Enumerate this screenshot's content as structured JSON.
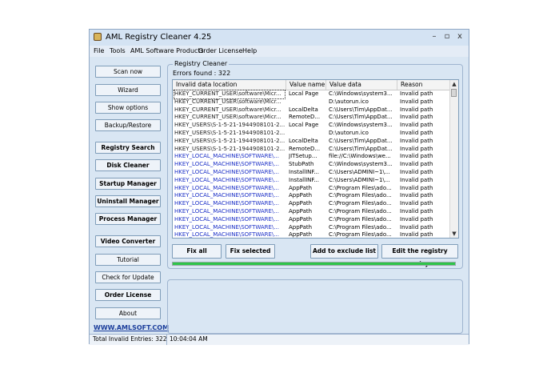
{
  "window": {
    "title": "AML Registry Cleaner 4.25",
    "controls": {
      "minimize": "–",
      "maximize": "▫",
      "close": "x"
    }
  },
  "menu": [
    "File",
    "Tools",
    "AML Software Products",
    "Order License",
    "Help"
  ],
  "sidebar": {
    "buttons": [
      {
        "label": "Scan now",
        "bold": false
      },
      {
        "label": "Wizard",
        "bold": false
      },
      {
        "label": "Show options",
        "bold": false
      },
      {
        "label": "Backup/Restore",
        "bold": false
      },
      {
        "label": "Registry Search",
        "bold": true
      },
      {
        "label": "Disk Cleaner",
        "bold": true
      },
      {
        "label": "Startup Manager",
        "bold": true
      },
      {
        "label": "Uninstall Manager",
        "bold": true
      },
      {
        "label": "Process Manager",
        "bold": true
      },
      {
        "label": "Video Converter",
        "bold": true
      },
      {
        "label": "Tutorial",
        "bold": false
      },
      {
        "label": "Check for Update",
        "bold": false
      },
      {
        "label": "Order License",
        "bold": true
      },
      {
        "label": "About",
        "bold": false
      }
    ],
    "website": "WWW.AMLSOFT.COM"
  },
  "registry_cleaner": {
    "group_title": "Registry Cleaner",
    "errors_found": "Errors found : 322",
    "columns": [
      "Invalid data location",
      "Value name",
      "Value data",
      "Reason"
    ],
    "rows": [
      {
        "location": "HKEY_CURRENT_USER\\software\\Micr...",
        "name": "Local Page",
        "data": "C:\\Windows\\system3...",
        "reason": "Invalid path",
        "type": "user",
        "selected": true
      },
      {
        "location": "HKEY_CURRENT_USER\\software\\Micr...",
        "name": "",
        "data": "D:\\autorun.ico",
        "reason": "Invalid path",
        "type": "user",
        "selected": false
      },
      {
        "location": "HKEY_CURRENT_USER\\software\\Micr...",
        "name": "LocalDelta",
        "data": "C:\\Users\\Tim\\AppDat...",
        "reason": "Invalid path",
        "type": "user",
        "selected": false
      },
      {
        "location": "HKEY_CURRENT_USER\\software\\Micr...",
        "name": "RemoteD...",
        "data": "C:\\Users\\Tim\\AppDat...",
        "reason": "Invalid path",
        "type": "user",
        "selected": false
      },
      {
        "location": "HKEY_USERS\\S-1-5-21-1944908101-2...",
        "name": "Local Page",
        "data": "C:\\Windows\\system3...",
        "reason": "Invalid path",
        "type": "user",
        "selected": false
      },
      {
        "location": "HKEY_USERS\\S-1-5-21-1944908101-2...",
        "name": "",
        "data": "D:\\autorun.ico",
        "reason": "Invalid path",
        "type": "user",
        "selected": false
      },
      {
        "location": "HKEY_USERS\\S-1-5-21-1944908101-2...",
        "name": "LocalDelta",
        "data": "C:\\Users\\Tim\\AppDat...",
        "reason": "Invalid path",
        "type": "user",
        "selected": false
      },
      {
        "location": "HKEY_USERS\\S-1-5-21-1944908101-2...",
        "name": "RemoteD...",
        "data": "C:\\Users\\Tim\\AppDat...",
        "reason": "Invalid path",
        "type": "user",
        "selected": false
      },
      {
        "location": "HKEY_LOCAL_MACHINE\\SOFTWARE\\...",
        "name": "JITSetup...",
        "data": "file://C:\\Windows\\we...",
        "reason": "Invalid path",
        "type": "sys",
        "selected": false
      },
      {
        "location": "HKEY_LOCAL_MACHINE\\SOFTWARE\\...",
        "name": "StubPath",
        "data": "C:\\Windows\\system3...",
        "reason": "Invalid path",
        "type": "sys",
        "selected": false
      },
      {
        "location": "HKEY_LOCAL_MACHINE\\SOFTWARE\\...",
        "name": "InstallINF...",
        "data": "C:\\Users\\ADMINI~1\\...",
        "reason": "Invalid path",
        "type": "sys",
        "selected": false
      },
      {
        "location": "HKEY_LOCAL_MACHINE\\SOFTWARE\\...",
        "name": "InstallINF...",
        "data": "C:\\Users\\ADMINI~1\\...",
        "reason": "Invalid path",
        "type": "sys",
        "selected": false
      },
      {
        "location": "HKEY_LOCAL_MACHINE\\SOFTWARE\\...",
        "name": "AppPath",
        "data": "C:\\Program Files\\ado...",
        "reason": "Invalid path",
        "type": "sys",
        "selected": false
      },
      {
        "location": "HKEY_LOCAL_MACHINE\\SOFTWARE\\...",
        "name": "AppPath",
        "data": "C:\\Program Files\\ado...",
        "reason": "Invalid path",
        "type": "sys",
        "selected": false
      },
      {
        "location": "HKEY_LOCAL_MACHINE\\SOFTWARE\\...",
        "name": "AppPath",
        "data": "C:\\Program Files\\ado...",
        "reason": "Invalid path",
        "type": "sys",
        "selected": false
      },
      {
        "location": "HKEY_LOCAL_MACHINE\\SOFTWARE\\...",
        "name": "AppPath",
        "data": "C:\\Program Files\\ado...",
        "reason": "Invalid path",
        "type": "sys",
        "selected": false
      },
      {
        "location": "HKEY_LOCAL_MACHINE\\SOFTWARE\\...",
        "name": "AppPath",
        "data": "C:\\Program Files\\ado...",
        "reason": "Invalid path",
        "type": "sys",
        "selected": false
      },
      {
        "location": "HKEY_LOCAL_MACHINE\\SOFTWARE\\...",
        "name": "AppPath",
        "data": "C:\\Program Files\\ado...",
        "reason": "Invalid path",
        "type": "sys",
        "selected": false
      },
      {
        "location": "HKEY_LOCAL_MACHINE\\SOFTWARE\\...",
        "name": "AppPath",
        "data": "C:\\Program Files\\ado...",
        "reason": "Invalid path",
        "type": "sys",
        "selected": false
      }
    ],
    "buttons": {
      "fix_all": "Fix all",
      "fix_selected": "Fix selected",
      "add_exclude": "Add to exclude list",
      "edit_entry": "Edit the registry entry"
    },
    "progress_fraction": 1.0
  },
  "statusbar": {
    "entries": "Total Invalid Entries: 322",
    "time": "10:04:04 AM"
  },
  "colors": {
    "window_bg": "#d9e6f3",
    "sys_text": "#1b2fc7",
    "progress": "#2ec44a",
    "link": "#1a3d9b"
  },
  "icons": {
    "app": "registry-cleaner-app-icon",
    "scroll_up": "scroll-up-arrow-icon",
    "scroll_down": "scroll-down-arrow-icon"
  }
}
